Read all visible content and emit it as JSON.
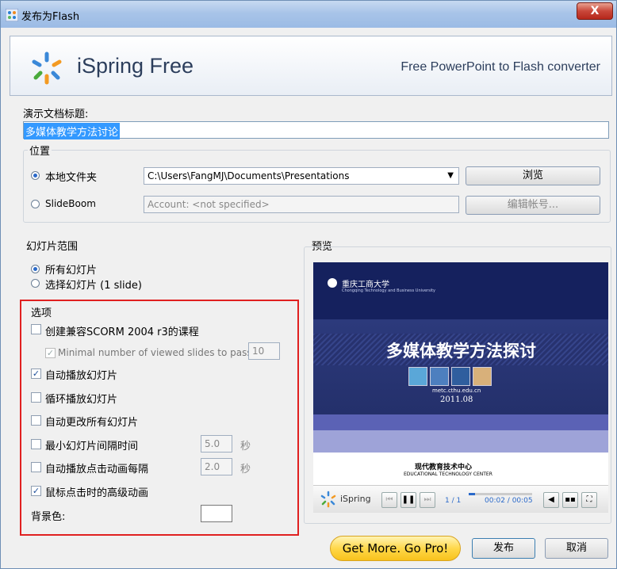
{
  "window": {
    "title": "发布为Flash",
    "close_label": "X"
  },
  "header": {
    "brand": "iSpring Free",
    "tagline": "Free PowerPoint to Flash converter"
  },
  "presentation_title": {
    "label": "演示文档标题:",
    "value": "多媒体教学方法讨论"
  },
  "location": {
    "legend": "位置",
    "local_label": "本地文件夹",
    "path": "C:\\Users\\FangMJ\\Documents\\Presentations",
    "browse_label": "浏览",
    "slideboom_label": "SlideBoom",
    "account_placeholder": "Account: <not specified>",
    "edit_account_label": "编辑帐号..."
  },
  "slide_range": {
    "legend": "幻灯片范围",
    "all": "所有幻灯片",
    "select": "选择幻灯片 (1 slide)"
  },
  "options": {
    "legend": "选项",
    "scorm": "创建兼容SCORM 2004 r3的课程",
    "min_slides": "Minimal number of viewed slides to pass",
    "min_slides_value": "10",
    "autoplay": "自动播放幻灯片",
    "loop": "循环播放幻灯片",
    "auto_advance": "自动更改所有幻灯片",
    "min_interval": "最小幻灯片间隔时间",
    "min_interval_value": "5.0",
    "min_interval_unit": "秒",
    "anim_interval": "自动播放点击动画每隔",
    "anim_interval_value": "2.0",
    "anim_interval_unit": "秒",
    "advanced_anim": "鼠标点击时的高级动画",
    "bgcolor": "背景色:"
  },
  "preview": {
    "legend": "预览",
    "slide_title": "多媒体教学方法探讨",
    "url": "metc.cthu.edu.cn",
    "date": "2011.08",
    "university": "重庆工商大学",
    "university_sub": "Chongqing Technology and Business University",
    "center_cn": "现代教育技术中心",
    "center_en": "EDUCATIONAL TECHNOLOGY CENTER",
    "player_brand": "iSpring",
    "slide_counter": "1 / 1",
    "time": "00:02 / 00:05"
  },
  "footer": {
    "gopro": "Get More. Go Pro!",
    "publish": "发布",
    "cancel": "取消"
  },
  "colors": {
    "accent": "#2a69c9",
    "highlight": "#3399ff",
    "outline": "#e02020"
  }
}
